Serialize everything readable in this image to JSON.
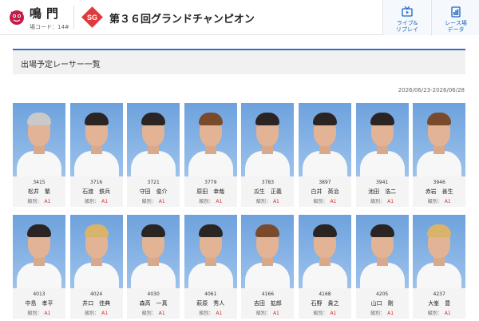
{
  "header": {
    "venue_name": "鳴門",
    "venue_code": "場コード：14#",
    "grade": "SG",
    "race_title": "第３６回グランドチャンピオン",
    "live_label_1": "ライブ&",
    "live_label_2": "リプレイ",
    "data_label_1": "レース場",
    "data_label_2": "データ"
  },
  "section_title": "出場予定レーサー一覧",
  "period": "2026/06/23-2026/06/28",
  "rank_label": "級別：",
  "colors": {
    "accent": "#2f6ec9",
    "grade_red": "#e0393e",
    "rank_red": "#d23030",
    "link_blue": "#1a64c2"
  },
  "racers": [
    {
      "number": "3415",
      "name": "松井　繁",
      "rank": "A1",
      "hair": "grey"
    },
    {
      "number": "3716",
      "name": "石渡　鉄兵",
      "rank": "A1",
      "hair": "dark"
    },
    {
      "number": "3721",
      "name": "守田　俊介",
      "rank": "A1",
      "hair": "dark"
    },
    {
      "number": "3779",
      "name": "原田　幸哉",
      "rank": "A1",
      "hair": "brown"
    },
    {
      "number": "3783",
      "name": "瓜生　正義",
      "rank": "A1",
      "hair": "dark"
    },
    {
      "number": "3897",
      "name": "白井　英治",
      "rank": "A1",
      "hair": "dark"
    },
    {
      "number": "3941",
      "name": "池田　浩二",
      "rank": "A1",
      "hair": "dark"
    },
    {
      "number": "3946",
      "name": "赤岩　善生",
      "rank": "A1",
      "hair": "brown"
    },
    {
      "number": "4013",
      "name": "中島　孝平",
      "rank": "A1",
      "hair": "dark"
    },
    {
      "number": "4024",
      "name": "井口　佳典",
      "rank": "A1",
      "hair": "blond"
    },
    {
      "number": "4030",
      "name": "森高　一真",
      "rank": "A1",
      "hair": "dark"
    },
    {
      "number": "4061",
      "name": "萩原　秀人",
      "rank": "A1",
      "hair": "dark"
    },
    {
      "number": "4166",
      "name": "吉田　拡郎",
      "rank": "A1",
      "hair": "brown"
    },
    {
      "number": "4168",
      "name": "石野　貴之",
      "rank": "A1",
      "hair": "dark"
    },
    {
      "number": "4205",
      "name": "山口　剛",
      "rank": "A1",
      "hair": "dark"
    },
    {
      "number": "4237",
      "name": "大峯　豊",
      "rank": "A1",
      "hair": "blond"
    }
  ]
}
